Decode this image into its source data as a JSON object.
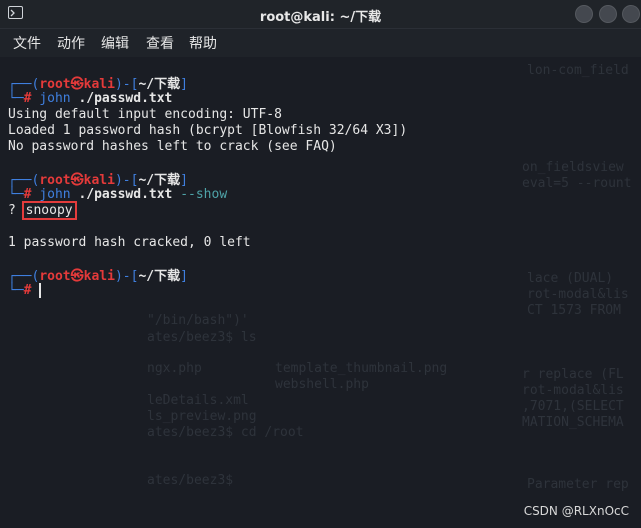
{
  "window": {
    "title": "root@kali: ~/下载"
  },
  "menu": {
    "items": [
      "文件",
      "动作",
      "编辑",
      "查看",
      "帮助"
    ]
  },
  "terminal": {
    "prompt1": {
      "open": "┌──(",
      "user": "root",
      "at": "㉿",
      "host": "kali",
      "mid": ")-[",
      "dir": "~/下载",
      "close": "]",
      "hash_prefix": "└─",
      "hash": "#"
    },
    "cmd1": {
      "bin": "john",
      "arg": "./passwd.txt"
    },
    "out1": [
      "Using default input encoding: UTF-8",
      "Loaded 1 password hash (bcrypt [Blowfish 32/64 X3])",
      "No password hashes left to crack (see FAQ)"
    ],
    "cmd2": {
      "bin": "john",
      "arg": "./passwd.txt",
      "flag": "--show"
    },
    "out2_prefix": "? ",
    "out2_password": "snoopy",
    "out2_summary": "1 password hash cracked, 0 left"
  },
  "watermark": "CSDN @RLXnOcC",
  "background_text": [
    "lon-com_field",
    "on_fieldsview",
    "eval=5 --rount",
    "lace (DUAL)",
    "rot-modal&lis",
    "CT 1573 FROM",
    "\"/bin/bash\")'",
    "ates/beez3$ ls",
    "ngx.php",
    "template_thumbnail.png",
    "webshell.php",
    "leDetails.xml",
    "ls_preview.png",
    "ates/beez3$ cd /root",
    "ates/beez3$",
    "r replace (FL",
    "rot-modal&lis",
    ",7071,(SELECT",
    "MATION_SCHEMA",
    "Parameter rep"
  ]
}
